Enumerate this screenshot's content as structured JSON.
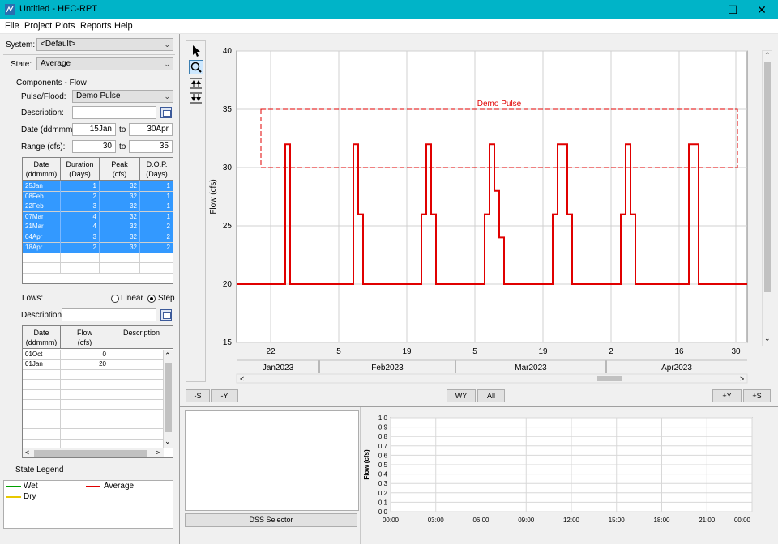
{
  "window": {
    "title": "Untitled - HEC-RPT",
    "app_icon": "hec-rpt-icon"
  },
  "menu": [
    "File",
    "Project",
    "Plots",
    "Reports",
    "Help"
  ],
  "left": {
    "system_label": "System:",
    "system_value": "<Default>",
    "state_label": "State:",
    "state_value": "Average",
    "components_title": "Components - Flow",
    "pulse_label": "Pulse/Flood:",
    "pulse_value": "Demo Pulse",
    "description_label": "Description:",
    "description_value": "",
    "date_label": "Date (ddmmm):",
    "date_from": "15Jan",
    "to1": "to",
    "date_to": "30Apr",
    "range_label": "Range (cfs):",
    "range_from": "30",
    "to2": "to",
    "range_to": "35",
    "pulse_table": {
      "headers": [
        [
          "Date",
          "(ddmmm)"
        ],
        [
          "Duration",
          "(Days)"
        ],
        [
          "Peak",
          "(cfs)"
        ],
        [
          "D.O.P.",
          "(Days)"
        ]
      ],
      "rows": [
        [
          "25Jan",
          "1",
          "32",
          "1"
        ],
        [
          "08Feb",
          "2",
          "32",
          "1"
        ],
        [
          "22Feb",
          "3",
          "32",
          "1"
        ],
        [
          "07Mar",
          "4",
          "32",
          "1"
        ],
        [
          "21Mar",
          "4",
          "32",
          "2"
        ],
        [
          "04Apr",
          "3",
          "32",
          "2"
        ],
        [
          "18Apr",
          "2",
          "32",
          "2"
        ]
      ]
    },
    "lows_label": "Lows:",
    "linear_label": "Linear",
    "step_label": "Step",
    "lows_description_label": "Description:",
    "lows_description_value": "",
    "lows_table": {
      "headers": [
        [
          "Date",
          "(ddmmm)"
        ],
        [
          "Flow",
          "(cfs)"
        ],
        [
          "Description",
          ""
        ]
      ],
      "rows": [
        [
          "01Oct",
          "0",
          ""
        ],
        [
          "01Jan",
          "20",
          ""
        ]
      ]
    },
    "state_legend_title": "State Legend",
    "legend": [
      {
        "label": "Wet",
        "color": "#00a000"
      },
      {
        "label": "Average",
        "color": "#e00000"
      },
      {
        "label": "Dry",
        "color": "#e8c800"
      }
    ]
  },
  "toolbar": {
    "tools": [
      "pointer-icon",
      "zoom-icon",
      "zoom-in-y-icon",
      "zoom-out-y-icon"
    ]
  },
  "bottom_buttons": {
    "minus_s": "-S",
    "minus_y": "-Y",
    "wy": "WY",
    "all": "All",
    "plus_y": "+Y",
    "plus_s": "+S"
  },
  "dss_selector_label": "DSS Selector",
  "chart_data": [
    {
      "type": "line",
      "ylabel": "Flow (cfs)",
      "ylim": [
        15,
        40
      ],
      "yticks": [
        15,
        20,
        25,
        30,
        35,
        40
      ],
      "xticks": [
        "22",
        "5",
        "19",
        "5",
        "19",
        "2",
        "16",
        "30"
      ],
      "month_labels": [
        "Jan2023",
        "Feb2023",
        "Mar2023",
        "Apr2023"
      ],
      "annotation": "Demo Pulse",
      "range_band": [
        30,
        35
      ],
      "series": [
        {
          "color": "#e00000",
          "x": [
            "2023-01-15",
            "2023-01-25",
            "2023-01-25",
            "2023-01-26",
            "2023-01-26",
            "2023-02-08",
            "2023-02-08",
            "2023-02-09",
            "2023-02-09",
            "2023-02-10",
            "2023-02-10",
            "2023-02-22",
            "2023-02-22",
            "2023-02-23",
            "2023-02-23",
            "2023-02-24",
            "2023-02-24",
            "2023-02-25",
            "2023-02-25",
            "2023-03-07",
            "2023-03-07",
            "2023-03-08",
            "2023-03-08",
            "2023-03-09",
            "2023-03-09",
            "2023-03-10",
            "2023-03-10",
            "2023-03-11",
            "2023-03-11",
            "2023-03-21",
            "2023-03-21",
            "2023-03-22",
            "2023-03-22",
            "2023-03-24",
            "2023-03-24",
            "2023-03-25",
            "2023-03-25",
            "2023-04-04",
            "2023-04-04",
            "2023-04-05",
            "2023-04-05",
            "2023-04-06",
            "2023-04-06",
            "2023-04-07",
            "2023-04-07",
            "2023-04-18",
            "2023-04-18",
            "2023-04-20",
            "2023-04-20",
            "2023-04-30"
          ],
          "y": [
            20,
            20,
            32,
            32,
            20,
            20,
            32,
            32,
            26,
            26,
            20,
            20,
            26,
            26,
            32,
            32,
            26,
            26,
            20,
            20,
            26,
            26,
            32,
            32,
            28,
            28,
            24,
            24,
            20,
            20,
            26,
            26,
            32,
            32,
            26,
            26,
            20,
            20,
            26,
            26,
            32,
            32,
            26,
            26,
            20,
            20,
            32,
            32,
            20,
            20
          ]
        }
      ]
    },
    {
      "type": "line",
      "ylabel": "Flow (cfs)",
      "ylim": [
        0.0,
        1.0
      ],
      "yticks": [
        "0.0",
        "0.1",
        "0.2",
        "0.3",
        "0.4",
        "0.5",
        "0.6",
        "0.7",
        "0.8",
        "0.9",
        "1.0"
      ],
      "xticks": [
        "00:00",
        "03:00",
        "06:00",
        "09:00",
        "12:00",
        "15:00",
        "18:00",
        "21:00",
        "00:00"
      ],
      "series": []
    }
  ]
}
